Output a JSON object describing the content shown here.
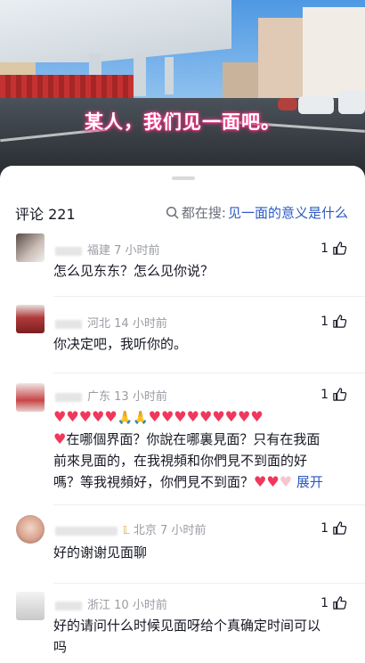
{
  "video": {
    "caption": "某人，我们见一面吧。"
  },
  "comments_panel": {
    "count_label": "评论 221",
    "search_prefix": "都在搜:",
    "search_query": "见一面的意义是什么"
  },
  "comments": [
    {
      "region": "福建",
      "time": "7 小时前",
      "text": "怎么见东东？怎么见你说？",
      "likes": "1"
    },
    {
      "region": "河北",
      "time": "14 小时前",
      "text": "你决定吧，我听你的。",
      "likes": "1"
    },
    {
      "region": "广东",
      "time": "13 小时前",
      "text_line_1": "在哪個界面？你說在哪裏見面？只有在我面",
      "text_line_2": "前來見面的，在我視頻和你們見不到面的好",
      "text_line_3": "嗎？等我視頻好，你們見不到面？",
      "expand_label": "展开",
      "likes": "1"
    },
    {
      "region": "北京",
      "time": "7 小时前",
      "text": "好的谢谢见面聊",
      "likes": "1"
    },
    {
      "region": "浙江",
      "time": "10 小时前",
      "text_line_1": "好的请问什么时候见面呀给个真确定时间可以",
      "text_line_2": "吗",
      "likes": "1"
    }
  ],
  "colors": {
    "link": "#2b59c3",
    "meta": "#9a9ca3",
    "caption_glow": "#ff3b8a"
  }
}
